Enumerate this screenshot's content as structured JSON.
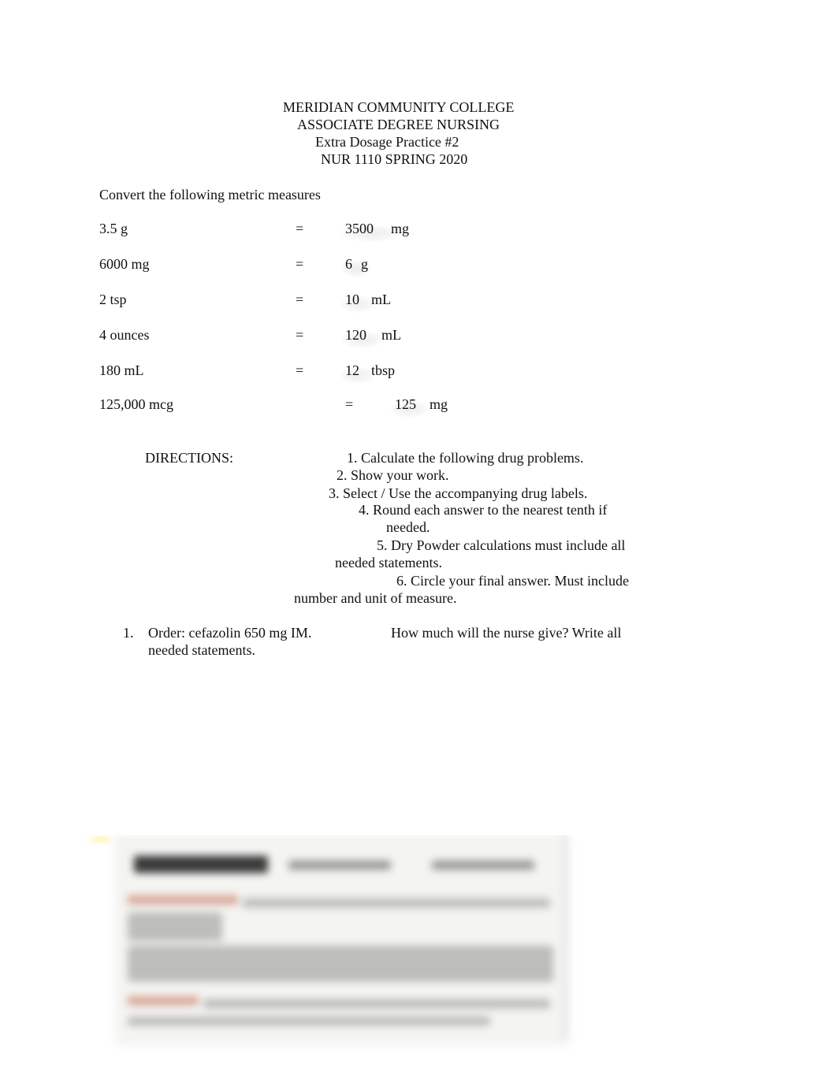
{
  "header": {
    "line1": "MERIDIAN COMMUNITY COLLEGE",
    "line2": "ASSOCIATE DEGREE NURSING",
    "line3": "Extra Dosage Practice #2",
    "line4": "NUR 1110 SPRING 2020"
  },
  "conversion": {
    "title": "Convert the following metric measures",
    "rows": [
      {
        "from": "3.5 g",
        "eq": "=",
        "answer": "3500",
        "unit": "mg"
      },
      {
        "from": "6000 mg",
        "eq": "=",
        "answer": "6",
        "unit": "g"
      },
      {
        "from": "2 tsp",
        "eq": "=",
        "answer": "10",
        "unit": "mL"
      },
      {
        "from": "4 ounces",
        "eq": "=",
        "answer": "120",
        "unit": "mL"
      },
      {
        "from": "180 mL",
        "eq": "=",
        "answer": "12",
        "unit": "tbsp"
      },
      {
        "from": "125,000 mcg",
        "eq": "=",
        "answer": "125",
        "unit": "mg"
      }
    ]
  },
  "directions": {
    "label": "DIRECTIONS:",
    "items": [
      "1. Calculate the following drug problems.",
      "2. Show your work.",
      "3. Select / Use the accompanying drug labels.",
      "4. Round each answer to the nearest tenth if",
      "needed.",
      "5. Dry Powder calculations must include all",
      "needed statements.",
      "6. Circle your final answer. Must include",
      "number and unit of measure."
    ]
  },
  "problems": [
    {
      "number": "1.",
      "order": "Order: cefazolin 650 mg IM.",
      "question": "How much will the nurse give? Write all",
      "question_cont": "needed statements."
    }
  ],
  "drug_label": {
    "state": "blurred"
  }
}
